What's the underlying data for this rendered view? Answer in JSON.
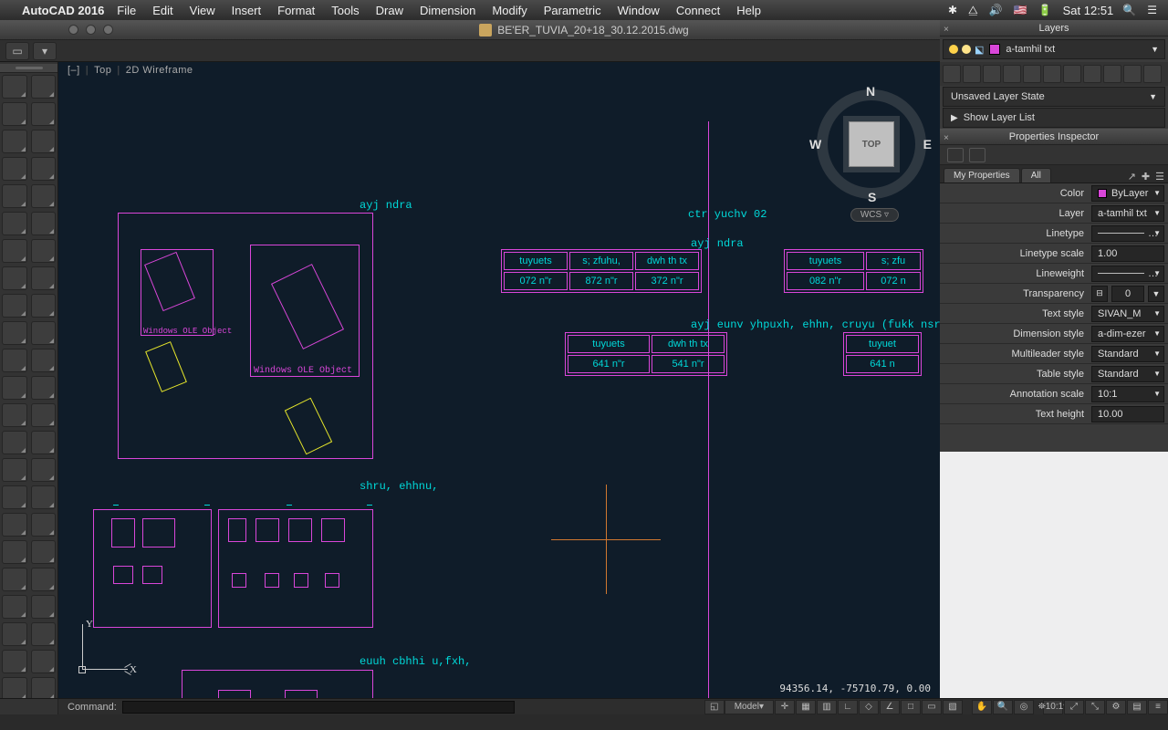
{
  "menubar": {
    "app": "AutoCAD 2016",
    "items": [
      "File",
      "Edit",
      "View",
      "Insert",
      "Format",
      "Tools",
      "Draw",
      "Dimension",
      "Modify",
      "Parametric",
      "Window",
      "Connect",
      "Help"
    ],
    "clock": "Sat 12:51"
  },
  "window": {
    "title": "BE'ER_TUVIA_20+18_30.12.2015.dwg"
  },
  "viewport": {
    "orientation": "Top",
    "visual": "2D Wireframe",
    "cube": "TOP",
    "wcs": "WCS",
    "coords": "94356.14, -75710.79, 0.00",
    "compass": {
      "n": "N",
      "s": "S",
      "e": "E",
      "w": "W"
    }
  },
  "drawing": {
    "labels": {
      "ayj_ndra_1": "ayj ndra",
      "ctr": "ctr yuchv 02",
      "ayj_ndra_2": "ayj ndra",
      "row3": "ayj eunv yhpuxh, ehhn, cruyu (fukk nsrdu,)",
      "shru": "shru, ehhnu,",
      "euuh": "euuh cbhhi u,fxh,",
      "ole": "Windows OLE Object",
      "ole2": "Windows OLE Object"
    },
    "table1": {
      "r1": [
        "tuyuets",
        "s; zfuhu,",
        "dwh th tx"
      ],
      "r2": [
        "072 n\"r",
        "872 n\"r",
        "372 n\"r"
      ]
    },
    "table1b": {
      "r1": [
        "tuyuets",
        "s; zfu"
      ],
      "r2": [
        "082 n\"r",
        "072 n"
      ]
    },
    "table2": {
      "r1": [
        "tuyuets",
        "dwh th tx"
      ],
      "r2": [
        "641 n\"r",
        "541 n\"r"
      ]
    },
    "table2b": {
      "r1": [
        "tuyuet"
      ],
      "r2": [
        "641 n"
      ]
    }
  },
  "layers": {
    "title": "Layers",
    "current": "a-tamhil txt",
    "state": "Unsaved Layer State",
    "showlist": "Show Layer List"
  },
  "props": {
    "title": "Properties Inspector",
    "tabs": [
      "My Properties",
      "All"
    ],
    "rows": {
      "Color": "ByLayer",
      "Layer": "a-tamhil txt",
      "Linetype": "…",
      "Linetype scale": "1.00",
      "Lineweight": "…",
      "Transparency": "0",
      "Text style": "SIVAN_M",
      "Dimension style": "a-dim-ezer",
      "Multileader style": "Standard",
      "Table style": "Standard",
      "Annotation scale": "10:1",
      "Text height": "10.00"
    }
  },
  "cmd": {
    "label": "Command:",
    "value": ""
  },
  "statusbar": {
    "space": "Model",
    "scale": "10:1"
  }
}
